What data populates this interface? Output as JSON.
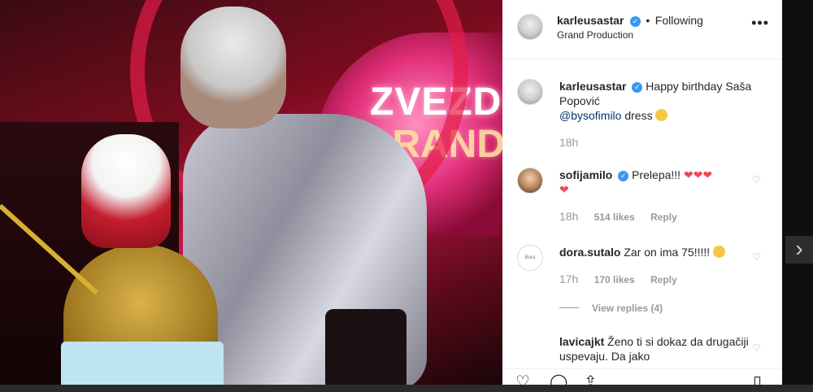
{
  "post": {
    "username": "karleusastar",
    "follow_status": "Following",
    "location": "Grand Production",
    "more_icon": "ellipsis-icon"
  },
  "caption": {
    "username": "karleusastar",
    "text": "Happy birthday Saša Popović",
    "mention": "@bysofimilo",
    "after_mention": " dress",
    "time": "18h"
  },
  "comments": [
    {
      "username": "sofijamilo",
      "text": "Prelepa!!!",
      "time": "18h",
      "likes": "514 likes",
      "reply": "Reply"
    },
    {
      "username": "dora.sutalo",
      "text": "Zar on ima 75!!!!!",
      "time": "17h",
      "likes": "170 likes",
      "reply": "Reply",
      "view_replies": "View replies (4)"
    },
    {
      "username": "lavicajkt",
      "text": "Ženo ti si dokaz da drugačiji uspevaju. Da jako",
      "time": ""
    }
  ],
  "photo": {
    "sign_line1": "ZVEZD",
    "sign_line2": "GRAND"
  },
  "logo_text": "Bora",
  "icons": {
    "like": "heart-icon",
    "comment": "comment-icon",
    "share": "share-icon",
    "save": "bookmark-icon",
    "next": "chevron-right-icon"
  },
  "colors": {
    "verified": "#3897f0",
    "link": "#003569",
    "heart": "#ed4956"
  }
}
